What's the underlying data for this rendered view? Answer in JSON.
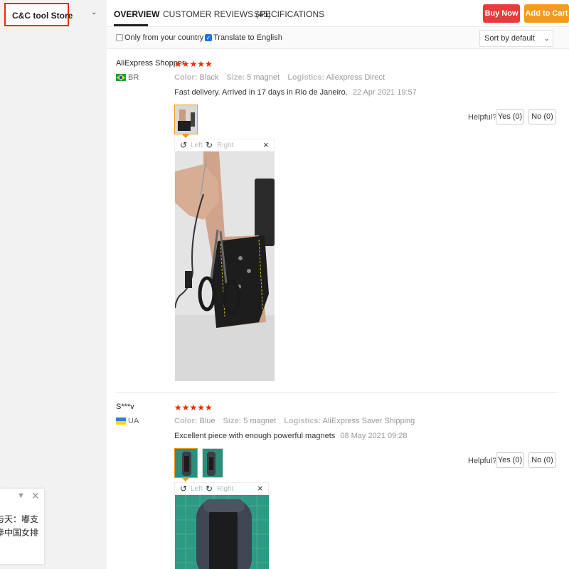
{
  "store": {
    "name": "C&C tool Store"
  },
  "tabs": [
    {
      "label": "OVERVIEW"
    },
    {
      "label": "CUSTOMER REVIEWS (45)"
    },
    {
      "label": "SPECIFICATIONS"
    }
  ],
  "actions": {
    "buy_now": "Buy Now",
    "add_to_cart": "Add to Cart"
  },
  "filters": {
    "only_country": "Only from your country",
    "translate": "Translate to English",
    "sort": "Sort by default"
  },
  "image_viewer": {
    "left": "Left",
    "right": "Right"
  },
  "reviews": [
    {
      "name": "AliExpress Shopper",
      "country": "BR",
      "stars": "★★★★★",
      "color_label": "Color:",
      "color": "Black",
      "size_label": "Size:",
      "size": "5 magnet",
      "logistics_label": "Logistics:",
      "logistics": "Aliexpress Direct",
      "text": "Fast delivery. Arrived in 17 days in Rio de Janeiro.",
      "date": "22 Apr 2021 19:57",
      "helpful": "Helpful?",
      "yes": "Yes (0)",
      "no": "No (0)"
    },
    {
      "name": "S***v",
      "country": "UA",
      "stars": "★★★★★",
      "color_label": "Color:",
      "color": "Blue",
      "size_label": "Size:",
      "size": "5 magnet",
      "logistics_label": "Logistics:",
      "logistics": "AliExpress Saver Shipping",
      "text": "Excellent piece with enough powerful magnets",
      "date": "08 May 2021 09:28",
      "helpful": "Helpful?",
      "yes": "Yes (0)",
      "no": "No (0)"
    }
  ],
  "chat": {
    "line1": "与天：嘟支",
    "line2": "奉中国女排"
  },
  "colors": {
    "buy": "#e93b3b",
    "cart": "#f29b1c",
    "star": "#e62e04",
    "highlight": "#e62e04"
  }
}
